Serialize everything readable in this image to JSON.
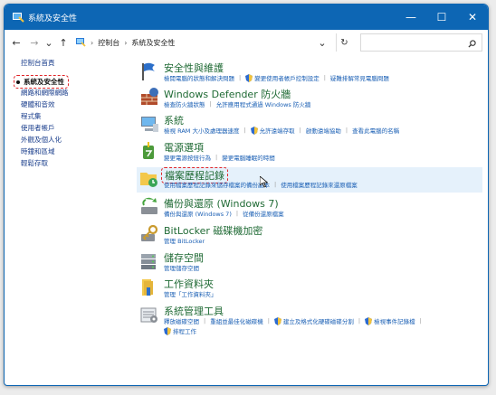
{
  "window": {
    "title": "系統及安全性"
  },
  "titlebar": {
    "min": "—",
    "max": "☐",
    "close": "✕"
  },
  "nav": {
    "back": "←",
    "forward": "→",
    "dropdown": "⌄",
    "up": "↑",
    "breadcrumb": [
      "控制台",
      "系統及安全性"
    ],
    "addr_dropdown": "⌄",
    "refresh": "↻",
    "search_placeholder": ""
  },
  "sidebar": {
    "home": "控制台首頁",
    "items": [
      "系統及安全性",
      "網路和網際網路",
      "硬體和音效",
      "程式集",
      "使用者帳戶",
      "外觀及個人化",
      "時鐘和區域",
      "輕鬆存取"
    ]
  },
  "categories": [
    {
      "title": "安全性與維護",
      "links": [
        "檢閱電腦的狀態和解決問題",
        "變更使用者帳戶控制設定",
        "疑難排解常見電腦問題"
      ]
    },
    {
      "title": "Windows Defender 防火牆",
      "links": [
        "檢查防火牆狀態",
        "允許應用程式通過 Windows 防火牆"
      ]
    },
    {
      "title": "系統",
      "links": [
        "檢視 RAM 大小及處理器速度",
        "允許遠端存取",
        "啟動遠端協助",
        "查看此電腦的名稱"
      ]
    },
    {
      "title": "電源選項",
      "links": [
        "變更電源按鈕行為",
        "變更電腦睡眠的時間"
      ]
    },
    {
      "title": "檔案歷程記錄",
      "links": [
        "使用檔案歷程記錄來儲存檔案的備份副本",
        "使用檔案歷程記錄來還原檔案"
      ]
    },
    {
      "title": "備份與還原 (Windows 7)",
      "links": [
        "備份與還原 (Windows 7)",
        "從備份還原檔案"
      ]
    },
    {
      "title": "BitLocker 磁碟機加密",
      "links": [
        "管理 BitLocker"
      ]
    },
    {
      "title": "儲存空間",
      "links": [
        "管理儲存空間"
      ]
    },
    {
      "title": "工作資料夾",
      "links": [
        "管理「工作資料夾」"
      ]
    },
    {
      "title": "系統管理工具",
      "links": [
        "釋放磁碟空間",
        "重組並最佳化磁碟機",
        "建立及格式化硬碟磁碟分割",
        "檢視事件記錄檔",
        "排程工作"
      ]
    }
  ],
  "colors": {
    "titlebar": "#0d66b4",
    "category_title": "#1f6a34",
    "link": "#1a5fb4",
    "annotation": "#e0262a",
    "hover_bg": "#e5f1fb"
  }
}
